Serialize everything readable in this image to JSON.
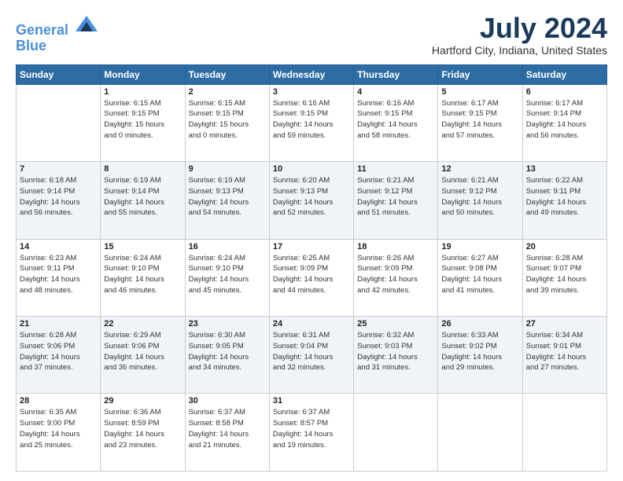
{
  "header": {
    "logo_line1": "General",
    "logo_line2": "Blue",
    "month_title": "July 2024",
    "location": "Hartford City, Indiana, United States"
  },
  "weekdays": [
    "Sunday",
    "Monday",
    "Tuesday",
    "Wednesday",
    "Thursday",
    "Friday",
    "Saturday"
  ],
  "weeks": [
    [
      {
        "day": "",
        "info": ""
      },
      {
        "day": "1",
        "info": "Sunrise: 6:15 AM\nSunset: 9:15 PM\nDaylight: 15 hours\nand 0 minutes."
      },
      {
        "day": "2",
        "info": "Sunrise: 6:15 AM\nSunset: 9:15 PM\nDaylight: 15 hours\nand 0 minutes."
      },
      {
        "day": "3",
        "info": "Sunrise: 6:16 AM\nSunset: 9:15 PM\nDaylight: 14 hours\nand 59 minutes."
      },
      {
        "day": "4",
        "info": "Sunrise: 6:16 AM\nSunset: 9:15 PM\nDaylight: 14 hours\nand 58 minutes."
      },
      {
        "day": "5",
        "info": "Sunrise: 6:17 AM\nSunset: 9:15 PM\nDaylight: 14 hours\nand 57 minutes."
      },
      {
        "day": "6",
        "info": "Sunrise: 6:17 AM\nSunset: 9:14 PM\nDaylight: 14 hours\nand 56 minutes."
      }
    ],
    [
      {
        "day": "7",
        "info": "Sunrise: 6:18 AM\nSunset: 9:14 PM\nDaylight: 14 hours\nand 56 minutes."
      },
      {
        "day": "8",
        "info": "Sunrise: 6:19 AM\nSunset: 9:14 PM\nDaylight: 14 hours\nand 55 minutes."
      },
      {
        "day": "9",
        "info": "Sunrise: 6:19 AM\nSunset: 9:13 PM\nDaylight: 14 hours\nand 54 minutes."
      },
      {
        "day": "10",
        "info": "Sunrise: 6:20 AM\nSunset: 9:13 PM\nDaylight: 14 hours\nand 52 minutes."
      },
      {
        "day": "11",
        "info": "Sunrise: 6:21 AM\nSunset: 9:12 PM\nDaylight: 14 hours\nand 51 minutes."
      },
      {
        "day": "12",
        "info": "Sunrise: 6:21 AM\nSunset: 9:12 PM\nDaylight: 14 hours\nand 50 minutes."
      },
      {
        "day": "13",
        "info": "Sunrise: 6:22 AM\nSunset: 9:11 PM\nDaylight: 14 hours\nand 49 minutes."
      }
    ],
    [
      {
        "day": "14",
        "info": "Sunrise: 6:23 AM\nSunset: 9:11 PM\nDaylight: 14 hours\nand 48 minutes."
      },
      {
        "day": "15",
        "info": "Sunrise: 6:24 AM\nSunset: 9:10 PM\nDaylight: 14 hours\nand 46 minutes."
      },
      {
        "day": "16",
        "info": "Sunrise: 6:24 AM\nSunset: 9:10 PM\nDaylight: 14 hours\nand 45 minutes."
      },
      {
        "day": "17",
        "info": "Sunrise: 6:25 AM\nSunset: 9:09 PM\nDaylight: 14 hours\nand 44 minutes."
      },
      {
        "day": "18",
        "info": "Sunrise: 6:26 AM\nSunset: 9:09 PM\nDaylight: 14 hours\nand 42 minutes."
      },
      {
        "day": "19",
        "info": "Sunrise: 6:27 AM\nSunset: 9:08 PM\nDaylight: 14 hours\nand 41 minutes."
      },
      {
        "day": "20",
        "info": "Sunrise: 6:28 AM\nSunset: 9:07 PM\nDaylight: 14 hours\nand 39 minutes."
      }
    ],
    [
      {
        "day": "21",
        "info": "Sunrise: 6:28 AM\nSunset: 9:06 PM\nDaylight: 14 hours\nand 37 minutes."
      },
      {
        "day": "22",
        "info": "Sunrise: 6:29 AM\nSunset: 9:06 PM\nDaylight: 14 hours\nand 36 minutes."
      },
      {
        "day": "23",
        "info": "Sunrise: 6:30 AM\nSunset: 9:05 PM\nDaylight: 14 hours\nand 34 minutes."
      },
      {
        "day": "24",
        "info": "Sunrise: 6:31 AM\nSunset: 9:04 PM\nDaylight: 14 hours\nand 32 minutes."
      },
      {
        "day": "25",
        "info": "Sunrise: 6:32 AM\nSunset: 9:03 PM\nDaylight: 14 hours\nand 31 minutes."
      },
      {
        "day": "26",
        "info": "Sunrise: 6:33 AM\nSunset: 9:02 PM\nDaylight: 14 hours\nand 29 minutes."
      },
      {
        "day": "27",
        "info": "Sunrise: 6:34 AM\nSunset: 9:01 PM\nDaylight: 14 hours\nand 27 minutes."
      }
    ],
    [
      {
        "day": "28",
        "info": "Sunrise: 6:35 AM\nSunset: 9:00 PM\nDaylight: 14 hours\nand 25 minutes."
      },
      {
        "day": "29",
        "info": "Sunrise: 6:36 AM\nSunset: 8:59 PM\nDaylight: 14 hours\nand 23 minutes."
      },
      {
        "day": "30",
        "info": "Sunrise: 6:37 AM\nSunset: 8:58 PM\nDaylight: 14 hours\nand 21 minutes."
      },
      {
        "day": "31",
        "info": "Sunrise: 6:37 AM\nSunset: 8:57 PM\nDaylight: 14 hours\nand 19 minutes."
      },
      {
        "day": "",
        "info": ""
      },
      {
        "day": "",
        "info": ""
      },
      {
        "day": "",
        "info": ""
      }
    ]
  ]
}
